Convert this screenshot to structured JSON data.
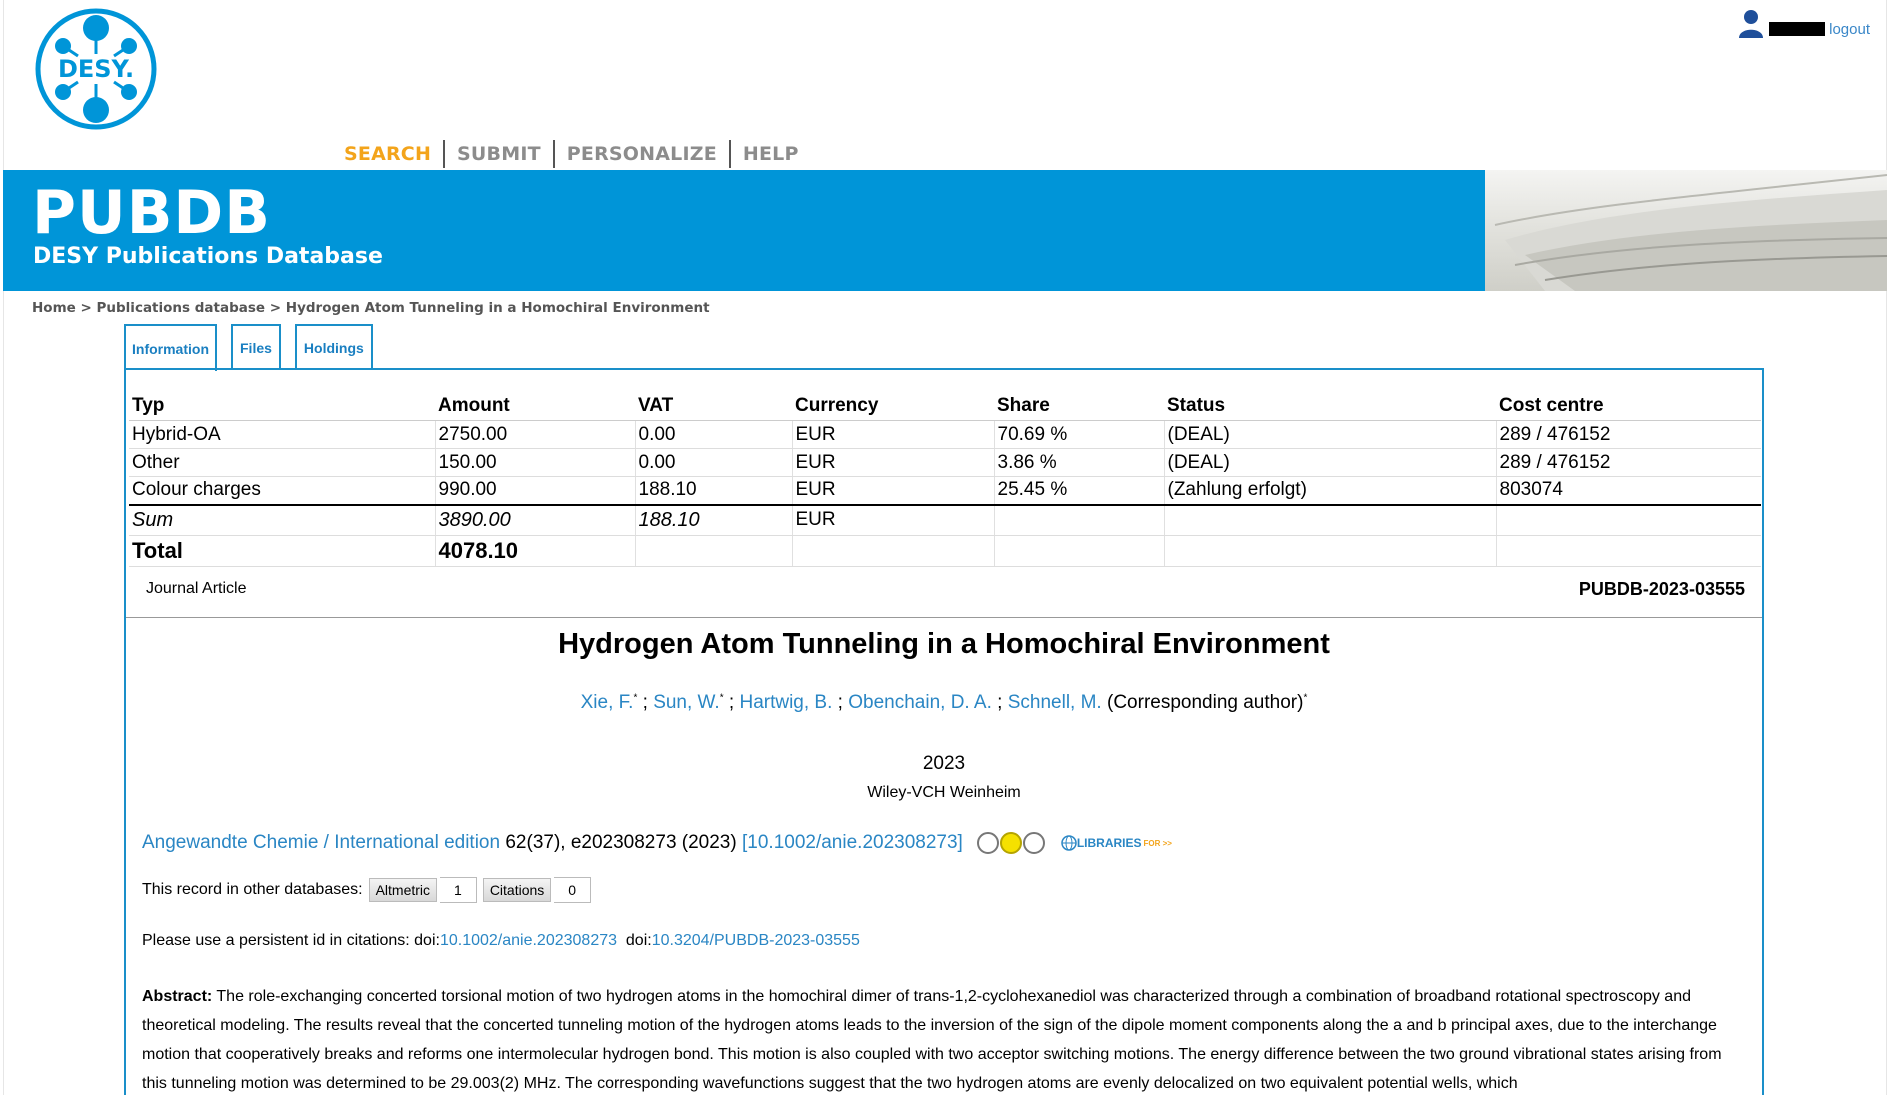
{
  "header": {
    "logo_text": "DESY.",
    "user": {
      "logout_label": "logout"
    },
    "nav": [
      "SEARCH",
      "SUBMIT",
      "PERSONALIZE",
      "HELP"
    ],
    "banner_title": "PUBDB",
    "banner_subtitle": "DESY Publications Database"
  },
  "breadcrumb": {
    "home": "Home",
    "sep": " > ",
    "section": "Publications database",
    "current": "Hydrogen Atom Tunneling in a Homochiral Environment"
  },
  "tabs": [
    "Information",
    "Files",
    "Holdings"
  ],
  "costs": {
    "headers": [
      "Typ",
      "Amount",
      "VAT",
      "Currency",
      "Share",
      "Status",
      "Cost centre"
    ],
    "rows": [
      [
        "Hybrid-OA",
        "2750.00",
        "0.00",
        "EUR",
        "70.69 %",
        "(DEAL)",
        "289 / 476152"
      ],
      [
        "Other",
        "150.00",
        "0.00",
        "EUR",
        "3.86 %",
        "(DEAL)",
        "289 / 476152"
      ],
      [
        "Colour charges",
        "990.00",
        "188.10",
        "EUR",
        "25.45 %",
        "(Zahlung erfolgt)",
        "803074"
      ]
    ],
    "sum": [
      "Sum",
      "3890.00",
      "188.10",
      "EUR"
    ],
    "total": [
      "Total",
      "4078.10"
    ]
  },
  "record": {
    "doc_type": "Journal Article",
    "id": "PUBDB-2023-03555",
    "title": "Hydrogen Atom Tunneling in a Homochiral Environment",
    "authors": [
      {
        "name": "Xie, F.",
        "mark": "*"
      },
      {
        "name": "Sun, W.",
        "mark": "*"
      },
      {
        "name": "Hartwig, B.",
        "mark": ""
      },
      {
        "name": "Obenchain, D. A.",
        "mark": ""
      },
      {
        "name": "Schnell, M.",
        "mark": ""
      }
    ],
    "corresponding": "(Corresponding author)",
    "corresponding_mark": "*",
    "year": "2023",
    "publisher": "Wiley-VCH Weinheim",
    "journal": "Angewandte Chemie / International edition",
    "journal_details": " 62(37), e202308273 (2023) ",
    "doi_link": "[10.1002/anie.202308273]",
    "libraries_label": "LIBRARIES",
    "libraries_suffix": "FOR >>",
    "other_db_label": "This record in other databases:",
    "altmetric_label": "Altmetric",
    "altmetric_count": "1",
    "citations_label": "Citations",
    "citations_count": "0",
    "pid_label": "Please use a persistent id in citations: doi:",
    "pid_doi1": "10.1002/anie.202308273",
    "pid_mid": "doi:",
    "pid_doi2": "10.3204/PUBDB-2023-03555",
    "abstract_label": "Abstract:",
    "abstract_text": " The role-exchanging concerted torsional motion of two hydrogen atoms in the homochiral dimer of trans-1,2-cyclohexanediol was characterized through a combination of broadband rotational spectroscopy and theoretical modeling. The results reveal that the concerted tunneling motion of the hydrogen atoms leads to the inversion of the sign of the dipole moment components along the a and b principal axes, due to the interchange motion that cooperatively breaks and reforms one intermolecular hydrogen bond. This motion is also coupled with two acceptor switching motions. The energy difference between the two ground vibrational states arising from this tunneling motion was determined to be 29.003(2) MHz. The corresponding wavefunctions suggest that the two hydrogen atoms are evenly delocalized on two equivalent potential wells, which"
  },
  "colors": {
    "brand_blue": "#0095d8",
    "link": "#2a86c4",
    "nav_active": "#f3a41b"
  }
}
